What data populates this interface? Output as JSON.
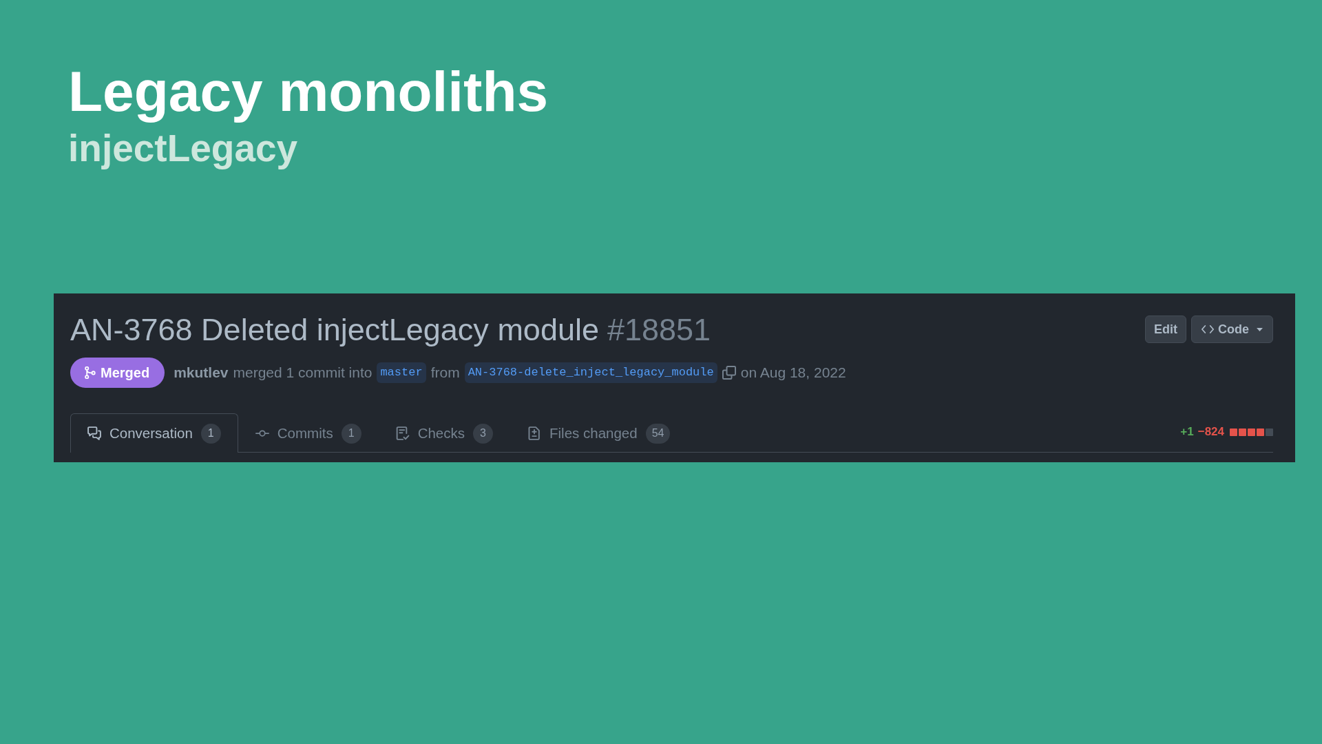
{
  "slide": {
    "title": "Legacy monoliths",
    "subtitle": "injectLegacy"
  },
  "pull_request": {
    "title": "AN-3768 Deleted injectLegacy module",
    "number": "#18851",
    "actions": [
      {
        "kind": "button",
        "label": "Edit"
      },
      {
        "kind": "code-menu",
        "label": "Code"
      }
    ],
    "status": {
      "kind": "merged",
      "label": "Merged"
    },
    "meta": [
      {
        "kind": "author",
        "text": "mkutlev"
      },
      {
        "kind": "text",
        "text": "merged 1 commit into"
      },
      {
        "kind": "branch",
        "text": "master"
      },
      {
        "kind": "text",
        "text": "from"
      },
      {
        "kind": "branch",
        "text": "AN-3768-delete_inject_legacy_module"
      },
      {
        "kind": "copy"
      },
      {
        "kind": "text",
        "text": "on Aug 18, 2022"
      }
    ],
    "tabs": [
      {
        "kind": "conversation",
        "label": "Conversation",
        "count": "1",
        "selected": true
      },
      {
        "kind": "commits",
        "label": "Commits",
        "count": "1",
        "selected": false
      },
      {
        "kind": "checks",
        "label": "Checks",
        "count": "3",
        "selected": false
      },
      {
        "kind": "files",
        "label": "Files changed",
        "count": "54",
        "selected": false
      }
    ],
    "diff_stat": {
      "additions": "+1",
      "deletions": "−824",
      "blocks": [
        {
          "color": "#e5534b"
        },
        {
          "color": "#e5534b"
        },
        {
          "color": "#e5534b"
        },
        {
          "color": "#e5534b"
        },
        {
          "color": "#444c56"
        }
      ]
    }
  }
}
